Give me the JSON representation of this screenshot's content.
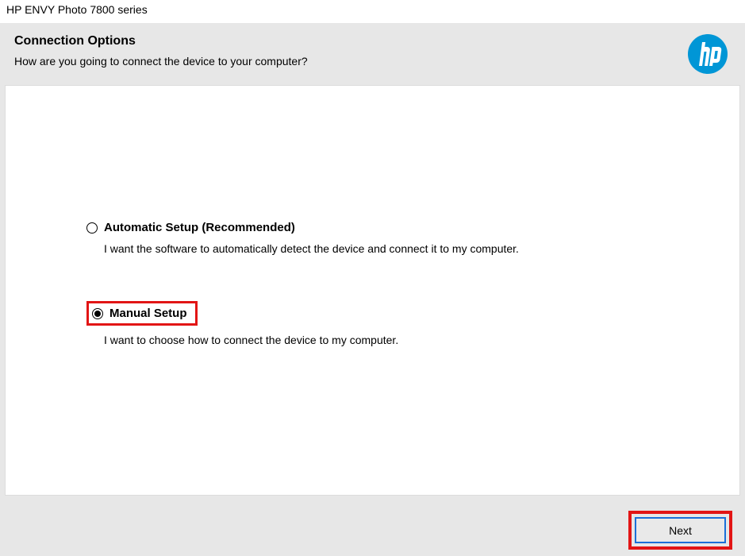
{
  "window_title": "HP ENVY Photo 7800 series",
  "header": {
    "title": "Connection Options",
    "subtitle": "How are you going to connect the device to your computer?"
  },
  "options": {
    "automatic": {
      "label": "Automatic Setup (Recommended)",
      "description": "I want the software to automatically detect the device and connect it to my computer.",
      "selected": false
    },
    "manual": {
      "label": "Manual Setup",
      "description": "I want to choose how to connect the device to my computer.",
      "selected": true
    }
  },
  "buttons": {
    "next": "Next"
  },
  "brand": {
    "logo_color": "#0096d6"
  }
}
